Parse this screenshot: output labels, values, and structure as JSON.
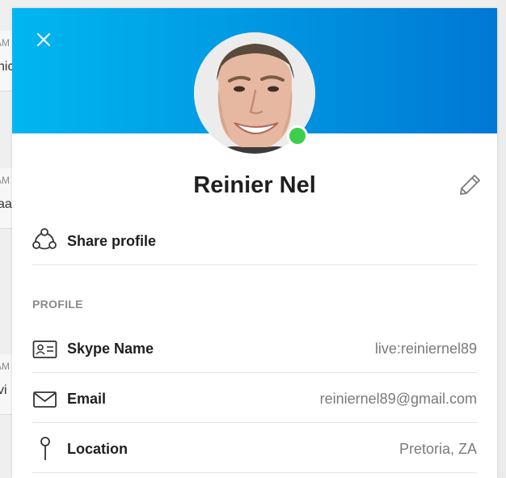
{
  "background": {
    "rows": [
      {
        "time": "AM",
        "message": "hic"
      },
      {
        "time": "AM",
        "message": "aa"
      },
      {
        "time": "AM",
        "message": "vi"
      }
    ]
  },
  "profile": {
    "display_name": "Reinier Nel",
    "status_color": "#3ccf4e",
    "share_label": "Share profile",
    "section_title": "PROFILE",
    "fields": [
      {
        "label": "Skype Name",
        "value": "live:reiniernel89",
        "icon": "contact-card-icon"
      },
      {
        "label": "Email",
        "value": "reiniernel89@gmail.com",
        "icon": "mail-icon"
      },
      {
        "label": "Location",
        "value": "Pretoria, ZA",
        "icon": "location-pin-icon"
      }
    ]
  },
  "colors": {
    "banner_start": "#00b7f0",
    "banner_end": "#0078d4"
  }
}
